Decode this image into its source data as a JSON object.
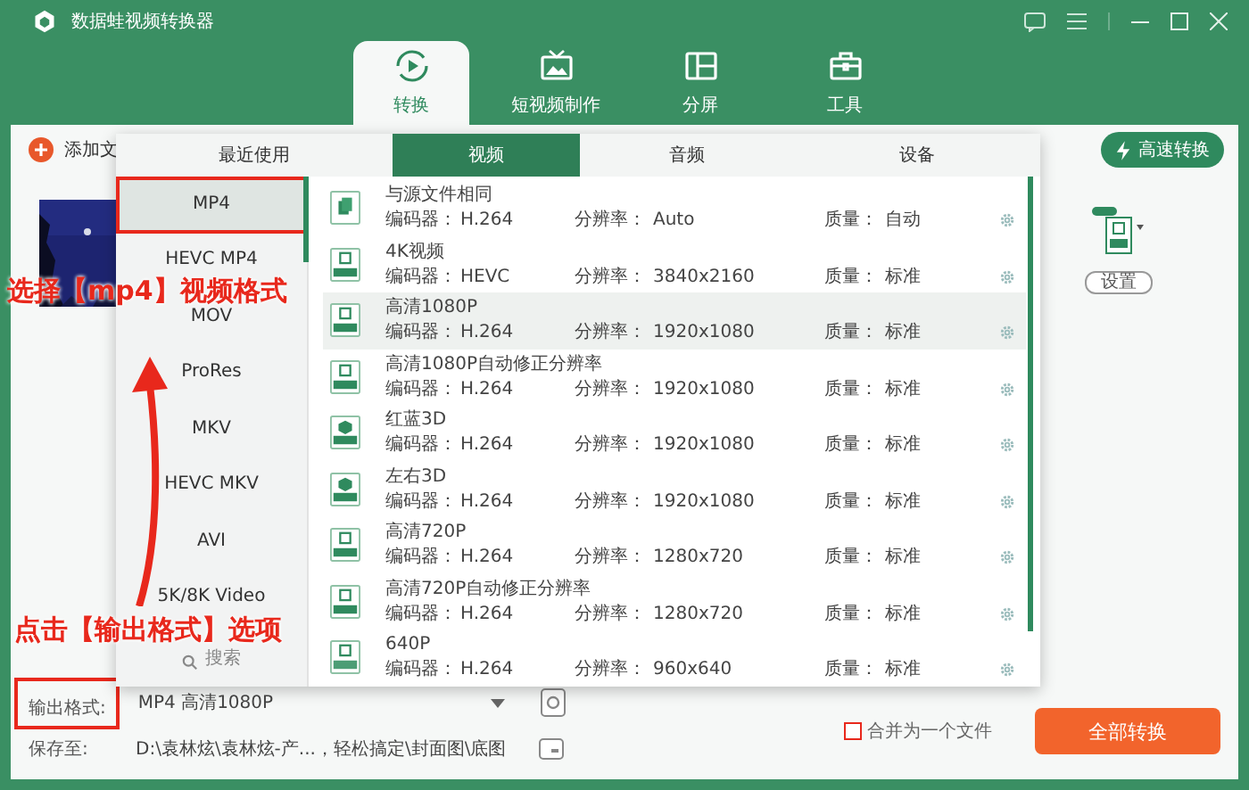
{
  "window": {
    "title": "数据蛙视频转换器"
  },
  "nav_tabs": [
    {
      "label": "转换",
      "selected": true
    },
    {
      "label": "短视频制作",
      "selected": false
    },
    {
      "label": "分屏",
      "selected": false
    },
    {
      "label": "工具",
      "selected": false
    }
  ],
  "toolbar": {
    "add_file": "添加文",
    "fast_convert": "高速转换"
  },
  "file_item": {
    "settings_button": "设置"
  },
  "format_popup": {
    "tabs": [
      {
        "label": "最近使用",
        "selected": false
      },
      {
        "label": "视频",
        "selected": true
      },
      {
        "label": "音频",
        "selected": false
      },
      {
        "label": "设备",
        "selected": false
      }
    ],
    "formats": [
      {
        "label": "MP4",
        "kind": "format",
        "selected": true
      },
      {
        "label": "HEVC MP4",
        "kind": "format",
        "selected": false
      },
      {
        "label": "MOV",
        "kind": "format",
        "selected": false
      },
      {
        "label": "ProRes",
        "kind": "format",
        "selected": false
      },
      {
        "label": "MKV",
        "kind": "format",
        "selected": false
      },
      {
        "label": "HEVC MKV",
        "kind": "format",
        "selected": false
      },
      {
        "label": "AVI",
        "kind": "format",
        "selected": false
      },
      {
        "label": "5K/8K Video",
        "kind": "format",
        "selected": false
      },
      {
        "label": "搜索",
        "kind": "search",
        "selected": false
      }
    ],
    "presets": [
      {
        "name": "与源文件相同",
        "kind": "copy",
        "highlighted": false,
        "codec_label": "编码器：",
        "codec": "H.264",
        "res_label": "分辨率：",
        "resolution": "Auto",
        "quality_label": "质量：",
        "quality": "自动"
      },
      {
        "name": "4K视频",
        "kind": "hd",
        "highlighted": false,
        "codec_label": "编码器：",
        "codec": "HEVC",
        "res_label": "分辨率：",
        "resolution": "3840x2160",
        "quality_label": "质量：",
        "quality": "标准"
      },
      {
        "name": "高清1080P",
        "kind": "hd",
        "highlighted": true,
        "codec_label": "编码器：",
        "codec": "H.264",
        "res_label": "分辨率：",
        "resolution": "1920x1080",
        "quality_label": "质量：",
        "quality": "标准"
      },
      {
        "name": "高清1080P自动修正分辨率",
        "kind": "hd",
        "highlighted": false,
        "codec_label": "编码器：",
        "codec": "H.264",
        "res_label": "分辨率：",
        "resolution": "1920x1080",
        "quality_label": "质量：",
        "quality": "标准"
      },
      {
        "name": "红蓝3D",
        "kind": "stereo",
        "highlighted": false,
        "codec_label": "编码器：",
        "codec": "H.264",
        "res_label": "分辨率：",
        "resolution": "1920x1080",
        "quality_label": "质量：",
        "quality": "标准"
      },
      {
        "name": "左右3D",
        "kind": "stereo",
        "highlighted": false,
        "codec_label": "编码器：",
        "codec": "H.264",
        "res_label": "分辨率：",
        "resolution": "1920x1080",
        "quality_label": "质量：",
        "quality": "标准"
      },
      {
        "name": "高清720P",
        "kind": "hd",
        "highlighted": false,
        "codec_label": "编码器：",
        "codec": "H.264",
        "res_label": "分辨率：",
        "resolution": "1280x720",
        "quality_label": "质量：",
        "quality": "标准"
      },
      {
        "name": "高清720P自动修正分辨率",
        "kind": "hd",
        "highlighted": false,
        "codec_label": "编码器：",
        "codec": "H.264",
        "res_label": "分辨率：",
        "resolution": "1280x720",
        "quality_label": "质量：",
        "quality": "标准"
      },
      {
        "name": "640P",
        "kind": "sd",
        "highlighted": false,
        "codec_label": "编码器：",
        "codec": "H.264",
        "res_label": "分辨率：",
        "resolution": "960x640",
        "quality_label": "质量：",
        "quality": "标准"
      }
    ]
  },
  "output": {
    "format_label": "输出格式:",
    "format_value": "MP4 高清1080P",
    "save_label": "保存至:",
    "save_path": "D:\\袁林炫\\袁林炫-产...，轻松搞定\\封面图\\底图"
  },
  "merge": {
    "label": "合并为一个文件",
    "checked": false
  },
  "convert_all": "全部转换",
  "annotations": [
    {
      "text": "选择【mp4】视频格式"
    },
    {
      "text": "点击【输出格式】选项"
    }
  ]
}
